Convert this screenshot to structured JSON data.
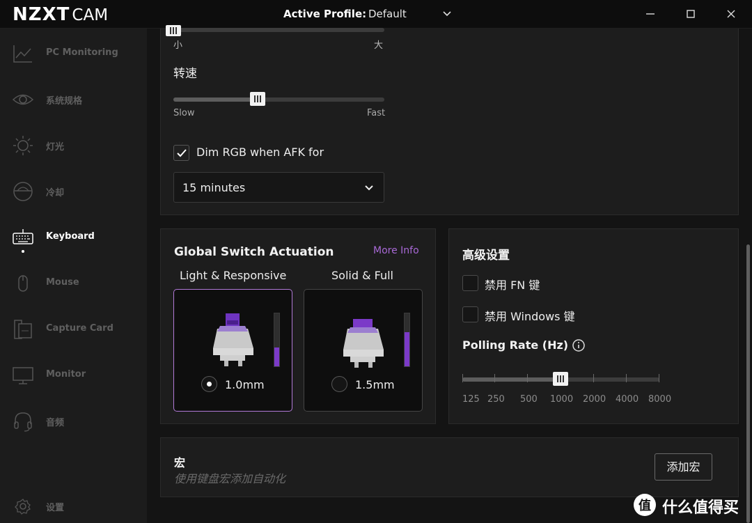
{
  "titlebar": {
    "logo_main": "NZXT",
    "logo_sub": "CAM",
    "profile_label": "Active Profile:",
    "profile_value": "Default"
  },
  "sidebar": {
    "items": [
      {
        "label": "PC Monitoring",
        "icon": "chart-line-icon"
      },
      {
        "label": "系统规格",
        "icon": "eye-icon"
      },
      {
        "label": "灯光",
        "icon": "sun-icon"
      },
      {
        "label": "冷却",
        "icon": "fan-gauge-icon"
      },
      {
        "label": "Keyboard",
        "icon": "keyboard-icon",
        "active": true
      },
      {
        "label": "Mouse",
        "icon": "mouse-icon"
      },
      {
        "label": "Capture Card",
        "icon": "capture-card-icon"
      },
      {
        "label": "Monitor",
        "icon": "monitor-icon"
      },
      {
        "label": "音频",
        "icon": "headset-icon"
      }
    ],
    "settings_label": "设置"
  },
  "lighting": {
    "size_min_label": "小",
    "size_max_label": "大",
    "speed_title": "转速",
    "speed_min_label": "Slow",
    "speed_max_label": "Fast",
    "speed_value": 0.4,
    "dim_label": "Dim RGB when AFK for",
    "dim_checked": true,
    "dim_duration": "15 minutes"
  },
  "actuation": {
    "title": "Global Switch Actuation",
    "more_info": "More Info",
    "options": [
      {
        "title": "Light & Responsive",
        "value": "1.0mm",
        "selected": true,
        "level": 0.35
      },
      {
        "title": "Solid & Full",
        "value": "1.5mm",
        "selected": false,
        "level": 0.65
      }
    ]
  },
  "advanced": {
    "title": "高级设置",
    "disable_fn": "禁用 FN 键",
    "disable_windows": "禁用 Windows 键",
    "polling_title": "Polling Rate (Hz)",
    "polling_ticks": [
      "125",
      "250",
      "500",
      "1000",
      "2000",
      "4000",
      "8000"
    ],
    "polling_selected": "1000"
  },
  "macro": {
    "title": "宏",
    "subtitle": "使用键盘宏添加自动化",
    "add_button": "添加宏"
  },
  "watermark": {
    "text": "什么值得买",
    "badge": "值"
  },
  "colors": {
    "accent": "#b27ad8",
    "switch_purple": "#7b3ac8",
    "more_info": "#a869d6"
  }
}
